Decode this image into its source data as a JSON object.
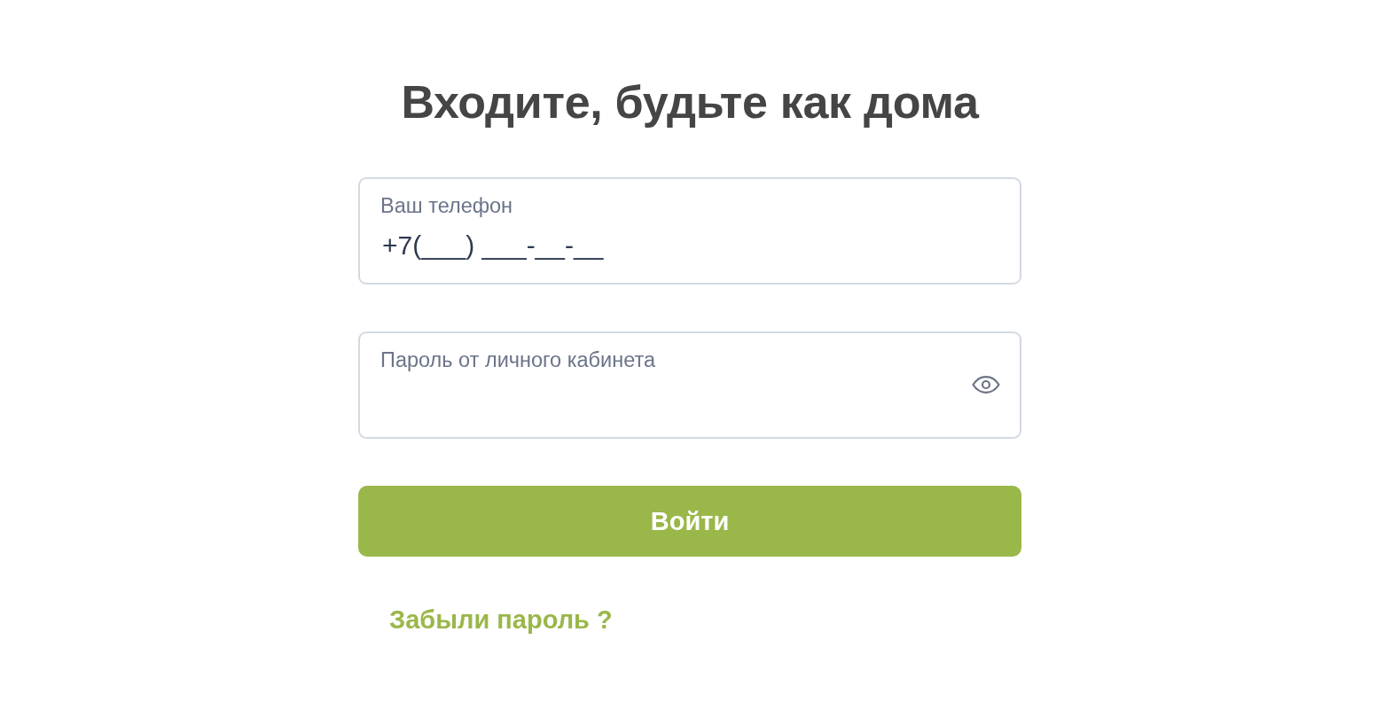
{
  "title": "Входите, будьте как дома",
  "fields": [
    {
      "kind": "text",
      "label": "Ваш телефон",
      "value": "+7(___) ___-__-__"
    },
    {
      "kind": "password",
      "label": "Пароль от личного кабинета"
    }
  ],
  "submit_button": {
    "label": "Войти"
  },
  "forgot_link": {
    "label": "Забыли пароль ?"
  }
}
